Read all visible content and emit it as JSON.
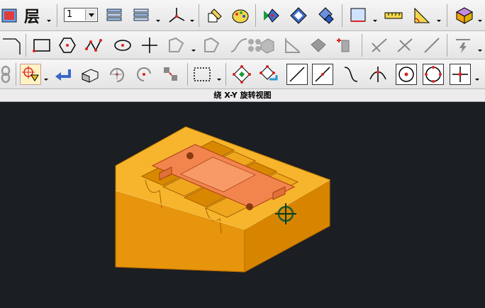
{
  "toolbar": {
    "layer_label": "层",
    "layer_select_value": "1",
    "buttons_row1": [
      "fit-view-icon",
      "layer-icon",
      "layer-list-icon",
      "layer-group-icon",
      "axis-icon",
      "edit-entity-icon",
      "paint-icon",
      "forward-view-icon",
      "view-ramp-icon",
      "view-steps-icon",
      "screen-grid-icon",
      "measure-icon",
      "analyze-angle-icon",
      "shaded-cube-icon"
    ],
    "buttons_row2": [
      "chamfer-line-icon",
      "rectangle-icon",
      "polygon-icon",
      "spline-icon",
      "ellipse-icon",
      "point-icon",
      "boundary-icon",
      "offset-contour-icon",
      "curve-icon",
      "dots-pattern-icon",
      "surface-icon",
      "trim-icon",
      "solid-icon",
      "extrude-icon",
      "modify-line-icon",
      "divide-icon",
      "break-icon",
      "trim-extend-icon"
    ],
    "buttons_row3": [
      "chain-icon",
      "select-icon",
      "undo-icon",
      "solid-shade-icon",
      "rotate-icon",
      "rotate-back-icon",
      "translate-icon",
      "window-select-icon",
      "select-all-icon",
      "toggle-select-icon",
      "line-sel-icon",
      "diag-line-icon",
      "curve-sel-icon",
      "intersect-icon",
      "center-point-icon",
      "quadrant-icon",
      "cross-point-icon"
    ]
  },
  "status": {
    "view_label": "绕 X-Y 旋转视图"
  },
  "colors": {
    "viewport_bg": "#1b1e22",
    "part_orange": "#f2a20c",
    "plate": "#f2844e"
  }
}
